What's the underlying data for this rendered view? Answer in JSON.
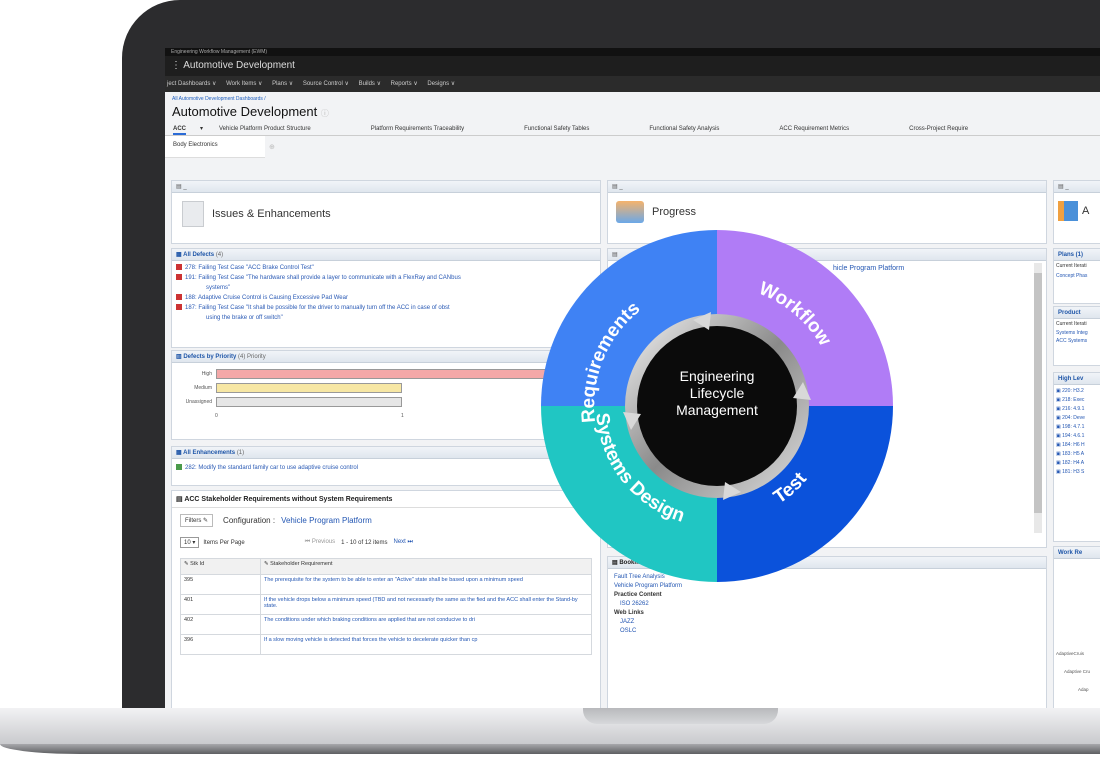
{
  "app": {
    "top_strip": "Engineering Workflow Management (EWM)",
    "project": "Automotive Development",
    "menu": [
      "ject Dashboards ∨",
      "Work Items ∨",
      "Plans ∨",
      "Source Control ∨",
      "Builds ∨",
      "Reports ∨",
      "Designs ∨"
    ]
  },
  "dashboard": {
    "breadcrumb": "All Automotive Development Dashboards /",
    "title": "Automotive Development",
    "tabs": [
      "ACC",
      "Vehicle Platform Product Structure",
      "Platform Requirements Traceability",
      "Functional Safety Tables",
      "Functional Safety Analysis",
      "ACC Requirement Metrics",
      "Cross-Project Require"
    ],
    "subtab": "Body Electronics"
  },
  "widgets": {
    "issues": {
      "title": "Issues & Enhancements"
    },
    "progress": {
      "title": "Progress"
    },
    "right_partial": {
      "title": "A"
    },
    "all_defects": {
      "title": "All Defects",
      "count": "(4)",
      "items": [
        "278: Failing Test Case \"ACC Brake Control Test\"",
        "191: Failing Test Case \"The hardware shall provide a layer to communicate with a FlexRay and CANbus",
        "systems\"",
        "188: Adaptive Cruise Control is Causing Excessive Pad Wear",
        "187: Failing Test Case \"It shall be possible for the driver to manually turn off the ACC in case of obst",
        "using the brake or off switch\""
      ]
    },
    "defects_priority": {
      "title": "Defects by Priority",
      "subtitle": "(4) Priority",
      "bars": [
        {
          "label": "High",
          "value": 3,
          "color": "#f4a8a8"
        },
        {
          "label": "Medium",
          "value": 1,
          "color": "#f7e7a4"
        },
        {
          "label": "Unassigned",
          "value": 1,
          "color": "#e6e6e6"
        }
      ],
      "x_ticks": [
        "0",
        "1"
      ]
    },
    "all_enhancements": {
      "title": "All Enhancements",
      "count": "(1)",
      "item": "282: Modify the standard family car to use adaptive cruise control"
    },
    "stakeholder": {
      "title": "ACC Stakeholder Requirements without System Requirements",
      "filters": "Filters",
      "config_label": "Configuration :",
      "config_value": "Vehicle Program Platform",
      "per_page_value": "10",
      "per_page_label": "Items Per Page",
      "pager_prev": "Previous",
      "pager_range": "1 - 10 of 12 items",
      "pager_next": "Next",
      "col_id": "Stk Id",
      "col_req": "Stakeholder Requirement",
      "rows": [
        {
          "id": "395",
          "req": "The prerequisite for the system to be able to enter an \"Active\" state shall be based upon a minimum speed"
        },
        {
          "id": "401",
          "req": "If the vehicle drops below a minimum speed (TBD and not necessarily the same as the fied and the ACC shall enter the Stand-by state."
        },
        {
          "id": "402",
          "req": "The conditions under which braking conditions are applied that are not conducive to dri"
        },
        {
          "id": "396",
          "req": "If a slow moving vehicle is detected that forces the vehicle to decelerate quicker than cp"
        }
      ]
    },
    "progress_item": "hicle Program Platform",
    "bookmarks": {
      "title": "Bookmark",
      "links": [
        "Fault Tree Analysis",
        "Vehicle Program Platform"
      ],
      "practice_heading": "Practice Content",
      "practice_item": "ISO 26262",
      "web_heading": "Web Links",
      "web_items": [
        "JAZZ",
        "OSLC"
      ]
    },
    "right_col": {
      "plans": "Plans (1)",
      "plans_row1": "Current Iterati",
      "plans_row2": "Concept Phas",
      "product": "Product",
      "product_row1": "Current Iterati",
      "product_row2": "Systems Integ",
      "product_row3": "ACC Systems",
      "high_level": "High Lev",
      "hl_items": [
        "220: H3.2",
        "218: Exec",
        "216: 4.9.1",
        "204: Deve",
        "198: 4.7.1",
        "194: 4.6.1",
        "184: H6 H",
        "183: H5 A",
        "182: H4 A",
        "181: H3 S"
      ],
      "work": "Work Re",
      "work_rows": [
        "AdaptiveCruis",
        "Adaptive Cru",
        "Adap"
      ]
    }
  },
  "wheel": {
    "center": [
      "Engineering",
      "Lifecycle",
      "Management"
    ],
    "segments": [
      {
        "label": "Requirements",
        "color": "#3f82f4"
      },
      {
        "label": "Workflow",
        "color": "#b07cf6"
      },
      {
        "label": "Test",
        "color": "#0b52db"
      },
      {
        "label": "Systems Design",
        "color": "#20c6c3"
      }
    ]
  }
}
